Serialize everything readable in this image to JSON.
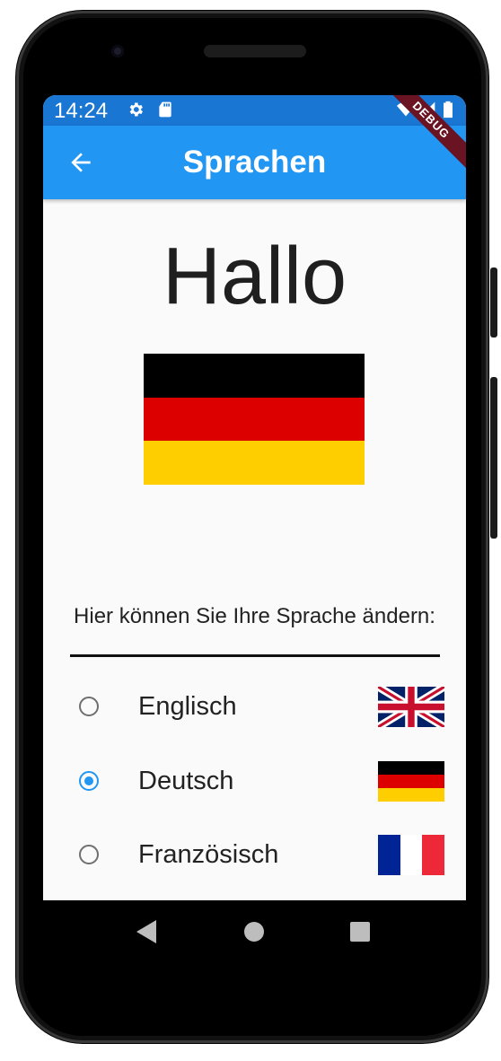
{
  "status_bar": {
    "time": "14:24",
    "icons": [
      "gear-icon",
      "sd-card-icon",
      "wifi-icon",
      "signal-icon",
      "battery-icon"
    ]
  },
  "debug_banner": "DEBUG",
  "app_bar": {
    "title": "Sprachen",
    "back_icon": "arrow-back-icon"
  },
  "main": {
    "greeting": "Hallo",
    "current_flag": "germany-flag",
    "instruction": "Hier können Sie Ihre Sprache ändern:"
  },
  "languages": [
    {
      "label": "Englisch",
      "flag": "uk-flag",
      "selected": false
    },
    {
      "label": "Deutsch",
      "flag": "germany-flag",
      "selected": true
    },
    {
      "label": "Französisch",
      "flag": "france-flag",
      "selected": false
    }
  ],
  "nav_bar": {
    "icons": [
      "back-triangle-icon",
      "home-circle-icon",
      "recents-square-icon"
    ]
  },
  "colors": {
    "primary": "#2196f3",
    "status_bar": "#1976d2",
    "de_black": "#000000",
    "de_red": "#dd0000",
    "de_gold": "#ffce00",
    "fr_blue": "#002395",
    "fr_red": "#ed2939",
    "uk_blue": "#012169",
    "uk_red": "#c8102e"
  }
}
